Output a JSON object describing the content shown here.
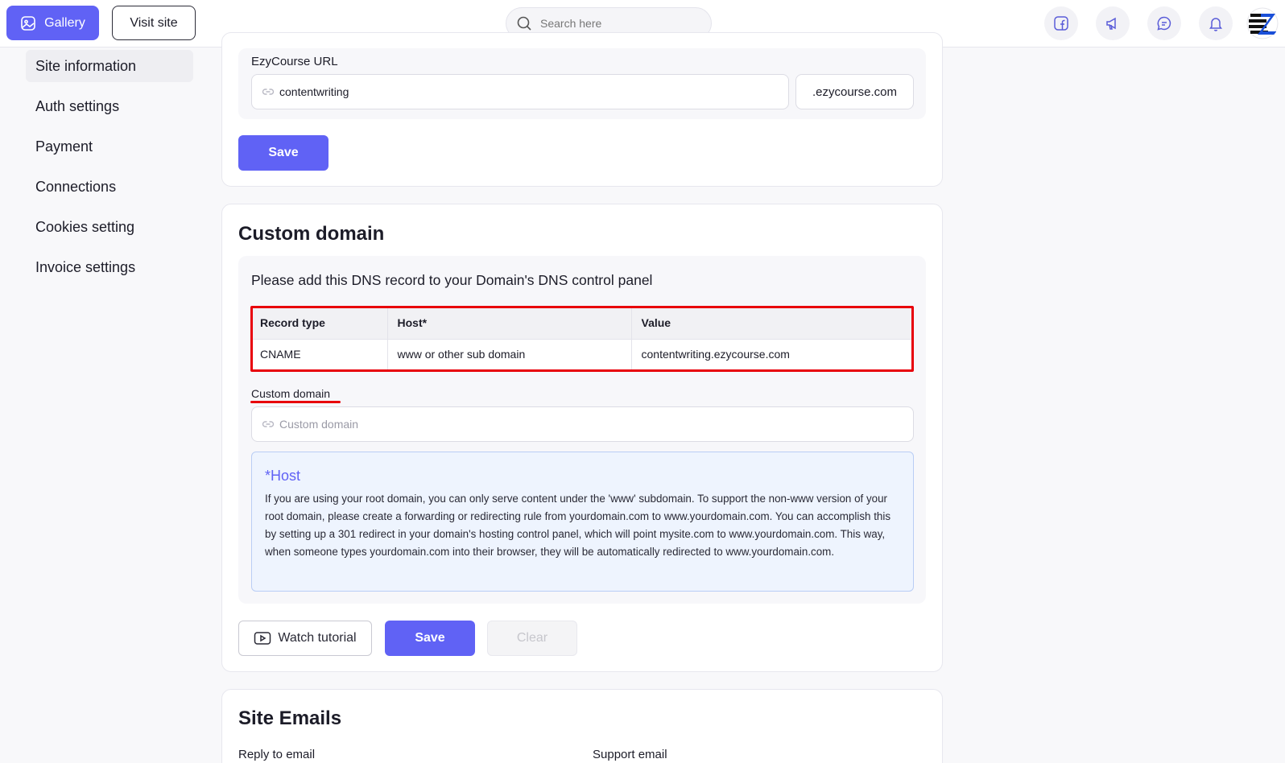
{
  "topbar": {
    "gallery_label": "Gallery",
    "visit_site_label": "Visit site",
    "search_placeholder": "Search here"
  },
  "sidebar": {
    "items": [
      {
        "label": "Site information",
        "active": true
      },
      {
        "label": "Auth settings"
      },
      {
        "label": "Payment"
      },
      {
        "label": "Connections"
      },
      {
        "label": "Cookies setting"
      },
      {
        "label": "Invoice settings"
      }
    ]
  },
  "site_info": {
    "url_label": "EzyCourse URL",
    "url_value": "contentwriting",
    "url_suffix": ".ezycourse.com",
    "save_label": "Save"
  },
  "custom_domain": {
    "title": "Custom domain",
    "instruction": "Please add this DNS record to your Domain's DNS control panel",
    "table": {
      "headers": [
        "Record type",
        "Host*",
        "Value"
      ],
      "rows": [
        [
          "CNAME",
          "www or other sub domain",
          "contentwriting.ezycourse.com"
        ]
      ]
    },
    "field_label": "Custom domain",
    "field_placeholder": "Custom domain",
    "host_title": "*Host",
    "host_text": "If you are using your root domain, you can only serve content under the 'www' subdomain. To support the non-www version of your root domain, please create a forwarding or redirecting rule from yourdomain.com to www.yourdomain.com. You can accomplish this by setting up a 301 redirect in your domain's hosting control panel, which will point mysite.com to www.yourdomain.com. This way, when someone types yourdomain.com into their browser, they will be automatically redirected to www.yourdomain.com.",
    "watch_label": "Watch tutorial",
    "save_label": "Save",
    "clear_label": "Clear"
  },
  "site_emails": {
    "title": "Site Emails",
    "reply_label": "Reply to email",
    "support_label": "Support email"
  },
  "colors": {
    "accent": "#6062f5",
    "highlight": "#e8000b"
  }
}
